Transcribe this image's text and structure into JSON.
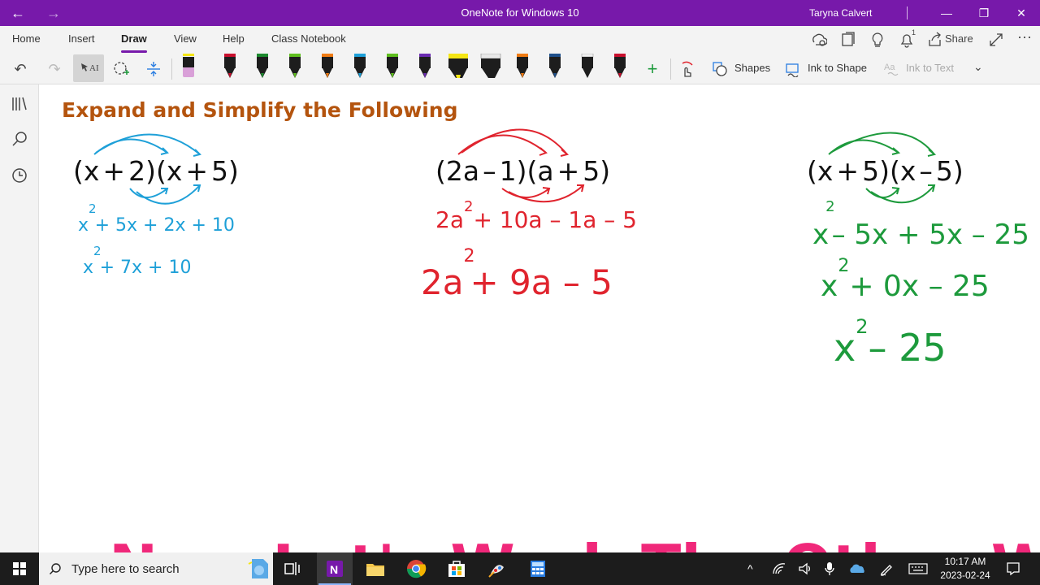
{
  "window": {
    "title": "OneNote for Windows 10",
    "user": "Taryna Calvert"
  },
  "tabs": [
    "Home",
    "Insert",
    "Draw",
    "View",
    "Help",
    "Class Notebook"
  ],
  "active_tab": "Draw",
  "ribbon_right": {
    "share_label": "Share",
    "bell_badge": "1"
  },
  "toolbar": {
    "shapes_label": "Shapes",
    "ink_to_shape_label": "Ink to Shape",
    "ink_to_text_label": "Ink to Text",
    "pen_colors": [
      "#d9a0d8",
      "#c8102e",
      "#1d8a2f",
      "#5fbf1f",
      "#f07c14",
      "#1ea0d8",
      "#1d1d1d",
      "#6a2ab0",
      "#f5e614",
      "#1d1d1d",
      "#f07c14",
      "#1f4f8a",
      "#1d1d1d",
      "#c8102e"
    ]
  },
  "page": {
    "heading": "Expand and Simplify the Following",
    "problems": [
      {
        "expression": [
          "(",
          "x",
          "+",
          "2",
          ")",
          "(",
          "x",
          "+",
          "5",
          ")"
        ],
        "ink_color": "#1ea0d8",
        "steps": [
          {
            "base": "x",
            "exp": "2",
            "rest": "+ 5x + 2x + 10"
          },
          {
            "base": "x",
            "exp": "2",
            "rest": "+ 7x + 10"
          }
        ]
      },
      {
        "expression": [
          "(",
          "2a",
          "–",
          "1",
          ")",
          "(",
          "a",
          "+",
          "5",
          ")"
        ],
        "ink_color": "#e0242e",
        "steps": [
          {
            "base": "2a",
            "exp": "2",
            "rest": "+ 10a – 1a – 5"
          },
          {
            "base": "2a",
            "exp": "2",
            "rest": "+ 9a – 5"
          }
        ]
      },
      {
        "expression": [
          "(",
          "x",
          "+",
          "5",
          ")",
          "(",
          "x",
          "–",
          "5",
          ")"
        ],
        "ink_color": "#1d9a3c",
        "steps": [
          {
            "base": "x",
            "exp": "2",
            "rest": "– 5x + 5x – 25"
          },
          {
            "base": "x",
            "exp": "2",
            "rest": "+ 0x – 25"
          },
          {
            "base": "x",
            "exp": "2",
            "rest": "– 25"
          }
        ]
      }
    ],
    "banner": "Now Let's Work The Other Way!",
    "heading_color": "#b4540e",
    "banner_color": "#f0287a"
  },
  "taskbar": {
    "search_placeholder": "Type here to search",
    "time": "10:17 AM",
    "date": "2023-02-24"
  }
}
